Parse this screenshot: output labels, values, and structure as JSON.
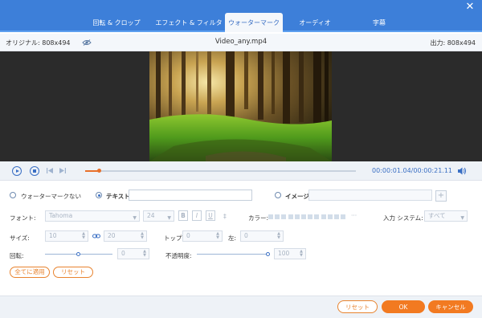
{
  "tabs": [
    {
      "label": "回転 & クロップ",
      "active": false
    },
    {
      "label": "エフェクト & フィルター",
      "active": false
    },
    {
      "label": "ウォーターマーク",
      "active": true
    },
    {
      "label": "オーディオ",
      "active": false
    },
    {
      "label": "字幕",
      "active": false
    }
  ],
  "window": {
    "close_icon": "close-icon"
  },
  "info": {
    "original": "オリジナル: 808x494",
    "filename": "Video_any.mp4",
    "output": "出力: 808x494"
  },
  "playback": {
    "timecode": "00:00:01.04/00:00:21.11",
    "progress": 0.05
  },
  "watermark": {
    "none_label": "ウォーターマークない",
    "text_label": "テキスト",
    "text_value": "",
    "image_label": "イメージ",
    "image_value": "",
    "selected": "text"
  },
  "font": {
    "label": "フォント:",
    "family": "Tahoma",
    "size": "24",
    "bold": "B",
    "italic": "I",
    "underline": "U",
    "strike": "‡",
    "color_label": "カラー:",
    "ellipsis": "···",
    "input_system_label": "入力 システム:",
    "input_system_value": "すべて"
  },
  "size": {
    "label": "サイズ:",
    "width": "10",
    "height": "20",
    "top_label": "トップ:",
    "top_value": "0",
    "left_label": "左:",
    "left_value": "0"
  },
  "rotation": {
    "label": "回転:",
    "value": "0",
    "level": 0.5
  },
  "opacity": {
    "label": "不透明度:",
    "value": "100",
    "level": 1.0
  },
  "actions": {
    "apply_all": "全てに適用",
    "reset": "リセット"
  },
  "footer": {
    "reset": "リセット",
    "ok": "OK",
    "cancel": "キャンセル"
  },
  "colors": {
    "accent_blue": "#3d7fd9",
    "accent_orange": "#f27a21"
  }
}
